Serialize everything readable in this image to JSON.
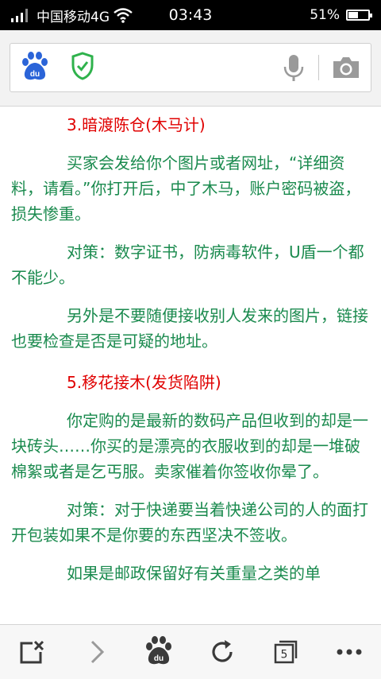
{
  "status_bar": {
    "carrier": "中国移动4G",
    "time": "03:43",
    "battery_percent": "51%",
    "battery_level": 0.51
  },
  "address_bar": {
    "placeholder": ""
  },
  "article": {
    "paragraphs": [
      {
        "type": "heading",
        "text": "3.暗渡陈仓(木马计)"
      },
      {
        "type": "body",
        "text": "买家会发给你个图片或者网址，“详细资料，请看。”你打开后，中了木马，账户密码被盗，损失惨重。"
      },
      {
        "type": "body",
        "text": "对策：数字证书，防病毒软件，U盾一个都不能少。"
      },
      {
        "type": "body",
        "text": "另外是不要随便接收别人发来的图片，链接也要检查是否是可疑的地址。"
      },
      {
        "type": "heading",
        "text": "5.移花接木(发货陷阱)"
      },
      {
        "type": "body",
        "text": "你定购的是最新的数码产品但收到的却是一块砖头……你买的是漂亮的衣服收到的却是一堆破棉絮或者是乞丐服。卖家催着你签收你晕了。"
      },
      {
        "type": "body",
        "text": "对策：对于快递要当着快递公司的人的面打开包装如果不是你要的东西坚决不签收。"
      },
      {
        "type": "body",
        "text": "如果是邮政保留好有关重量之类的单"
      }
    ]
  },
  "toolbar": {
    "tab_count": "5"
  },
  "colors": {
    "heading": "#e00000",
    "body": "#1a8a4e",
    "shield": "#2fb24c",
    "baidu": "#2b64d8"
  }
}
